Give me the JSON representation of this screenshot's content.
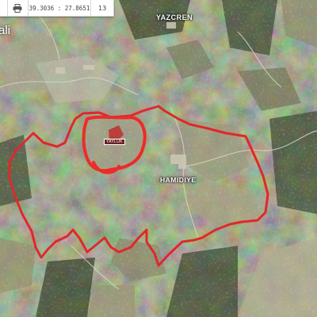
{
  "toolbar": {
    "print_icon": "printer-icon",
    "coordinates": "39.3036 : 27.8651",
    "zoom": "13"
  },
  "map": {
    "labels": {
      "top_village": "YAZCREN",
      "center_village": "HAMIDIYE",
      "mine_marker": "YAYLUK",
      "left_edge_partial": "ali"
    },
    "colors": {
      "boundary": "#e0282a",
      "mine_outline": "#ee2a2a",
      "terrain_base": "#5b6448"
    }
  }
}
